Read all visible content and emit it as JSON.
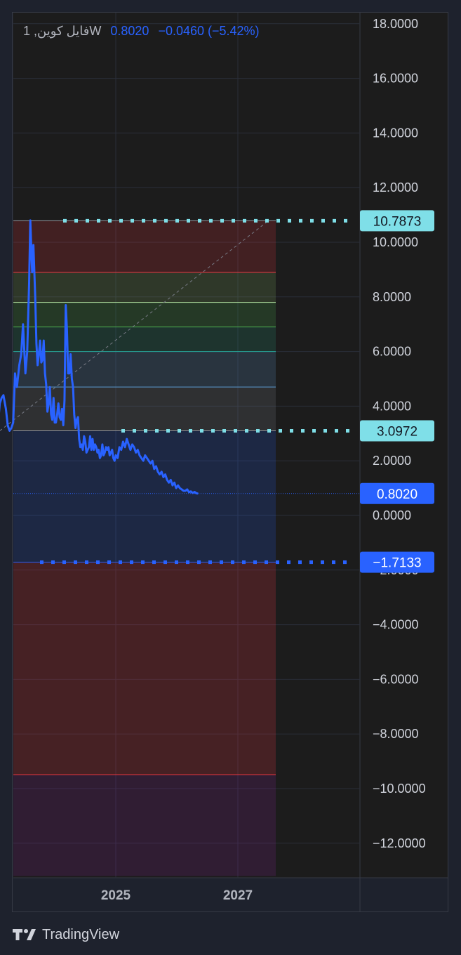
{
  "legend": {
    "symbol": "فایل کوین, 1W",
    "price": "0.8020",
    "change": "−0.0460 (−5.42%)"
  },
  "footer": {
    "brand": "TradingView"
  },
  "colors": {
    "background": "#1e222d",
    "pane": "#1c1c1c",
    "line": "#2962ff",
    "fib_label_cyan": "#7fdfe8",
    "price_label": "#2962ff"
  },
  "chart_data": {
    "type": "line",
    "ylim": [
      -13.2,
      18.5
    ],
    "y_ticks": [
      18,
      16,
      14,
      12,
      10,
      8,
      6,
      4,
      2,
      0,
      -2,
      -4,
      -6,
      -8,
      -10,
      -12
    ],
    "y_tick_labels": [
      "18.0000",
      "16.0000",
      "14.0000",
      "12.0000",
      "10.0000",
      "8.0000",
      "6.0000",
      "4.0000",
      "2.0000",
      "0.0000",
      "−2.0000",
      "−4.0000",
      "−6.0000",
      "−8.0000",
      "−10.0000",
      "−12.0000"
    ],
    "x_ticks": [
      2025,
      2027
    ],
    "x_tick_labels": [
      "2025",
      "2027"
    ],
    "xlim": [
      2023.0,
      2027.9
    ],
    "series": [
      {
        "x": [
          2023.0,
          2023.02,
          2023.05,
          2023.08,
          2023.1,
          2023.13,
          2023.16,
          2023.2,
          2023.23,
          2023.26,
          2023.29,
          2023.32,
          2023.35,
          2023.38,
          2023.42,
          2023.45,
          2023.48,
          2023.52,
          2023.55,
          2023.58,
          2023.6,
          2023.63,
          2023.65,
          2023.68,
          2023.7,
          2023.72,
          2023.74,
          2023.76,
          2023.78,
          2023.8,
          2023.82,
          2023.84,
          2023.86,
          2023.88,
          2023.9,
          2023.92,
          2023.94,
          2023.96,
          2023.98,
          2024.0,
          2024.02,
          2024.04,
          2024.06,
          2024.08,
          2024.1,
          2024.12,
          2024.14,
          2024.16,
          2024.18,
          2024.2,
          2024.22,
          2024.24,
          2024.26,
          2024.28,
          2024.3,
          2024.32,
          2024.34,
          2024.36,
          2024.38,
          2024.4,
          2024.42,
          2024.44,
          2024.46,
          2024.48,
          2024.5,
          2024.52,
          2024.54,
          2024.56,
          2024.58,
          2024.6,
          2024.62,
          2024.64,
          2024.66,
          2024.68,
          2024.7,
          2024.72,
          2024.74,
          2024.76,
          2024.78,
          2024.8,
          2024.82,
          2024.84,
          2024.86,
          2024.88,
          2024.9,
          2024.92,
          2024.94,
          2024.96,
          2024.98,
          2025.0,
          2025.03,
          2025.06,
          2025.09,
          2025.12,
          2025.15,
          2025.18,
          2025.21,
          2025.24,
          2025.27,
          2025.3,
          2025.33,
          2025.36,
          2025.39,
          2025.42,
          2025.45,
          2025.48,
          2025.51,
          2025.54,
          2025.57,
          2025.6,
          2025.63,
          2025.66,
          2025.69,
          2025.72,
          2025.75,
          2025.78,
          2025.81,
          2025.84,
          2025.87,
          2025.9,
          2025.93,
          2025.96,
          2025.99,
          2026.02,
          2026.05,
          2026.08,
          2026.11,
          2026.14,
          2026.17,
          2026.2,
          2026.23,
          2026.26,
          2026.29,
          2026.32,
          2026.35
        ],
        "y": [
          5.4,
          4.4,
          4.6,
          3.6,
          4.1,
          4.3,
          4.4,
          3.9,
          3.3,
          3.1,
          3.2,
          3.4,
          5.2,
          4.7,
          5.5,
          5.9,
          7.0,
          5.2,
          6.0,
          8.5,
          10.8,
          8.9,
          9.9,
          8.0,
          6.3,
          5.5,
          5.9,
          6.4,
          5.6,
          5.7,
          6.4,
          5.2,
          4.8,
          3.8,
          4.1,
          4.7,
          3.7,
          3.5,
          4.3,
          3.4,
          3.4,
          3.7,
          4.1,
          3.6,
          3.5,
          3.9,
          3.3,
          4.2,
          7.7,
          6.8,
          5.2,
          5.2,
          5.9,
          5.0,
          4.7,
          3.7,
          3.2,
          3.5,
          3.6,
          2.8,
          2.5,
          2.6,
          2.4,
          2.9,
          2.7,
          2.3,
          2.4,
          2.5,
          2.9,
          2.4,
          2.8,
          2.4,
          2.6,
          2.5,
          2.3,
          2.4,
          2.1,
          2.2,
          2.6,
          2.2,
          2.3,
          2.5,
          2.4,
          2.5,
          2.2,
          2.3,
          2.4,
          2.1,
          2.0,
          2.2,
          2.1,
          2.5,
          2.4,
          2.7,
          2.5,
          2.8,
          2.6,
          2.4,
          2.6,
          2.5,
          2.3,
          2.4,
          2.2,
          2.1,
          2.0,
          2.2,
          2.1,
          2.0,
          1.9,
          2.0,
          1.7,
          1.8,
          1.6,
          1.5,
          1.6,
          1.4,
          1.5,
          1.3,
          1.2,
          1.3,
          1.1,
          1.2,
          1.0,
          1.1,
          1.0,
          0.95,
          0.9,
          0.9,
          0.95,
          0.85,
          0.88,
          0.82,
          0.86,
          0.81,
          0.8
        ]
      }
    ],
    "fib_levels": [
      10.7873,
      8.9,
      7.8,
      6.9,
      6.0,
      4.7,
      3.0972,
      -1.7133,
      -9.5
    ],
    "labels": {
      "top": "10.7873",
      "mid": "3.0972",
      "last": "0.8020",
      "low": "−1.7133"
    }
  }
}
